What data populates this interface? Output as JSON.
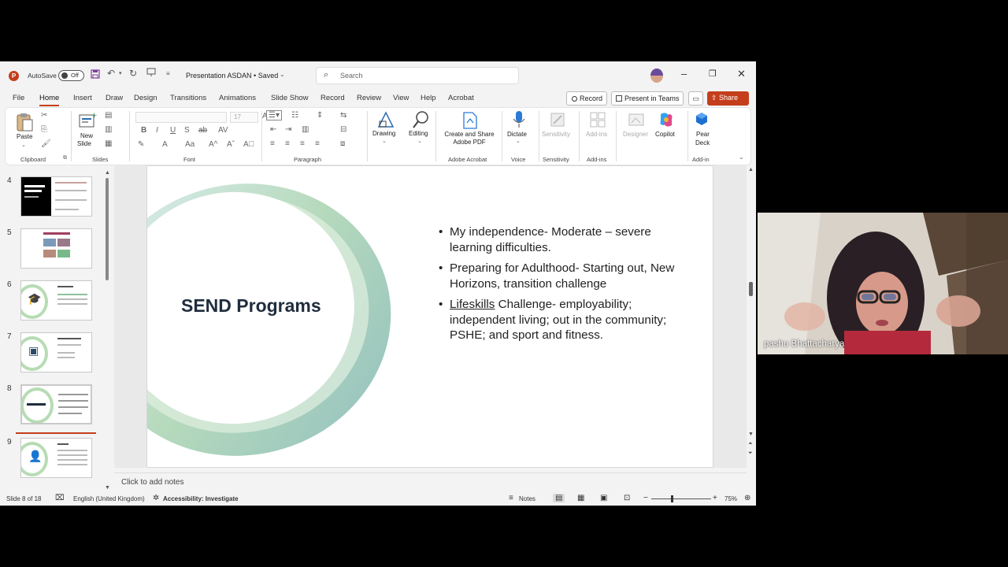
{
  "window": {
    "autosave_label": "AutoSave",
    "autosave_state": "Off",
    "doc_title": "Presentation ASDAN  •  Saved",
    "search_placeholder": "Search"
  },
  "tabs": [
    "File",
    "Home",
    "Insert",
    "Draw",
    "Design",
    "Transitions",
    "Animations",
    "Slide Show",
    "Record",
    "Review",
    "View",
    "Help",
    "Acrobat"
  ],
  "active_tab": "Home",
  "actions": {
    "record": "Record",
    "present_in_teams": "Present in Teams",
    "share": "Share"
  },
  "ribbon": {
    "clipboard": {
      "paste": "Paste",
      "group": "Clipboard"
    },
    "slides": {
      "new_slide_1": "New",
      "new_slide_2": "Slide",
      "group": "Slides"
    },
    "font": {
      "size": "17",
      "group": "Font"
    },
    "paragraph": {
      "group": "Paragraph"
    },
    "drawing": "Drawing",
    "editing": "Editing",
    "acrobat": {
      "create_1": "Create and Share",
      "create_2": "Adobe PDF",
      "group": "Adobe Acrobat"
    },
    "voice": {
      "dictate": "Dictate",
      "group": "Voice"
    },
    "sensitivity": {
      "label": "Sensitivity",
      "group": "Sensitivity"
    },
    "addins": {
      "label": "Add-ins",
      "group": "Add-ins"
    },
    "designer": "Designer",
    "copilot": "Copilot",
    "pear_deck_1": "Pear",
    "pear_deck_2": "Deck",
    "addin_group": "Add-in"
  },
  "thumbnails": [
    {
      "num": "4"
    },
    {
      "num": "5"
    },
    {
      "num": "6"
    },
    {
      "num": "7"
    },
    {
      "num": "8"
    },
    {
      "num": "9"
    }
  ],
  "slide": {
    "title": "SEND Programs",
    "bullets": [
      {
        "text": "My independence- Moderate – severe learning difficulties."
      },
      {
        "text": "Preparing for Adulthood- Starting out, New Horizons, transition challenge"
      },
      {
        "lead": "Lifeskills",
        "text": " Challenge- employability; independent living; out in the community; PSHE; and sport and fitness."
      }
    ]
  },
  "notes_placeholder": "Click to add notes",
  "status": {
    "slide_count": "Slide 8 of 18",
    "language": "English (United Kingdom)",
    "accessibility": "Accessibility: Investigate",
    "notes": "Notes",
    "zoom": "75%"
  },
  "video": {
    "participant": "pashu Bhattacharya"
  },
  "colors": {
    "accent": "#c43e1c",
    "title_text": "#1f2d3d",
    "ring_green": "#8fc98a",
    "ring_teal": "#7fb5b5"
  }
}
